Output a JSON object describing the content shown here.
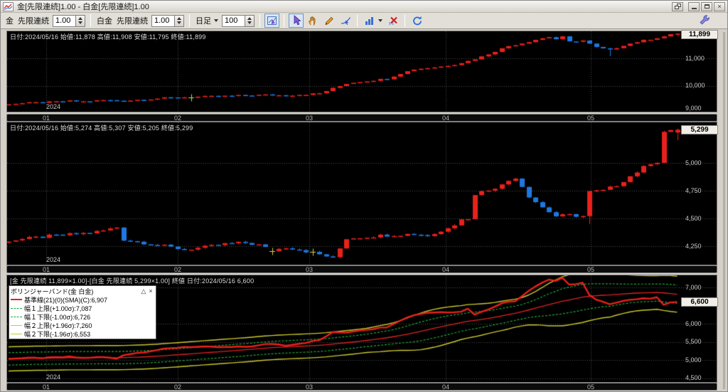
{
  "window": {
    "title": "金[先限連続]1.00 - 白金[先限連続]1.00",
    "controls": [
      "stack-windows",
      "minimize",
      "maximize",
      "close"
    ]
  },
  "toolbar": {
    "gold_label": "金",
    "gold_series": "先限連続",
    "gold_ratio": "1.00",
    "platinum_label": "白金",
    "platinum_series": "先限連続",
    "platinum_ratio": "1.00",
    "period_label": "日足",
    "bar_count": "100",
    "tool_icons": [
      "crosshair-chart",
      "select-cursor",
      "pan-hand",
      "draw-pencil",
      "trendline-cursor",
      "bar-chart-type",
      "delete-drawings",
      "refresh"
    ],
    "settings_icon": "wrench"
  },
  "year": "2024",
  "x_tick_labels": [
    "01",
    "02",
    "03",
    "04",
    "05"
  ],
  "colors": {
    "up_candle": "#e8211c",
    "down_candle": "#1e78e0",
    "doji": "#d8cf4f",
    "grid": "#4e4e4e",
    "band_inner": "#1fa83c",
    "band_outer": "#c9c92c",
    "centerline": "#dd2222",
    "spread_line": "#e8211c"
  },
  "chart_data": [
    {
      "type": "candlestick",
      "instrument": "金 先限連続",
      "multiplier": "1.00",
      "info": "日付:2024/05/16 始値:11,878 高値:11,908 安値:11,795 終値:11,899",
      "date": "2024/05/16",
      "open": 11878,
      "high": 11908,
      "low": 11795,
      "close": 11899,
      "badge": "11,899",
      "y_ticks": [
        {
          "v": 11000,
          "label": "11,000"
        },
        {
          "v": 10000,
          "label": "10,000"
        },
        {
          "v": 9000,
          "label": "9,000"
        }
      ],
      "close_keyframes": [
        [
          0,
          9340
        ],
        [
          3,
          9370
        ],
        [
          6,
          9400
        ],
        [
          9,
          9440
        ],
        [
          11,
          9420
        ],
        [
          14,
          9470
        ],
        [
          17,
          9450
        ],
        [
          20,
          9500
        ],
        [
          23,
          9550
        ],
        [
          26,
          9580
        ],
        [
          29,
          9600
        ],
        [
          32,
          9620
        ],
        [
          35,
          9645
        ],
        [
          38,
          9665
        ],
        [
          41,
          9645
        ],
        [
          44,
          9685
        ],
        [
          46,
          9720
        ],
        [
          48,
          9900
        ],
        [
          50,
          10080
        ],
        [
          52,
          10150
        ],
        [
          54,
          10200
        ],
        [
          56,
          10260
        ],
        [
          58,
          10450
        ],
        [
          60,
          10600
        ],
        [
          62,
          10650
        ],
        [
          64,
          10700
        ],
        [
          66,
          10780
        ],
        [
          68,
          10900
        ],
        [
          70,
          11060
        ],
        [
          72,
          11260
        ],
        [
          74,
          11450
        ],
        [
          76,
          11550
        ],
        [
          78,
          11680
        ],
        [
          80,
          11780
        ],
        [
          81,
          11700
        ],
        [
          82,
          11780
        ],
        [
          83,
          11600
        ],
        [
          85,
          11650
        ],
        [
          87,
          11400
        ],
        [
          89,
          11300
        ],
        [
          91,
          11480
        ],
        [
          93,
          11600
        ],
        [
          95,
          11700
        ],
        [
          97,
          11800
        ],
        [
          98,
          11860
        ],
        [
          99,
          11899
        ]
      ],
      "doji_indices": [
        27
      ],
      "wick_low_overrides": {
        "89": 11080,
        "99": 11795
      },
      "wick_high_overrides": {
        "99": 11908
      },
      "open_overrides": {
        "99": 11878
      }
    },
    {
      "type": "candlestick",
      "instrument": "白金 先限連続",
      "multiplier": "1.00",
      "info": "日付:2024/05/16 始値:5,274 高値:5,307 安値:5,205 終値:5,299",
      "date": "2024/05/16",
      "open": 5274,
      "high": 5307,
      "low": 5205,
      "close": 5299,
      "badge": "5,299",
      "y_ticks": [
        {
          "v": 5000,
          "label": "5,000"
        },
        {
          "v": 4750,
          "label": "4,750"
        },
        {
          "v": 4500,
          "label": "4,500"
        },
        {
          "v": 4250,
          "label": "4,250"
        }
      ],
      "close_keyframes": [
        [
          0,
          4300
        ],
        [
          3,
          4320
        ],
        [
          6,
          4340
        ],
        [
          9,
          4355
        ],
        [
          12,
          4370
        ],
        [
          14,
          4390
        ],
        [
          16,
          4420
        ],
        [
          17,
          4310
        ],
        [
          20,
          4280
        ],
        [
          23,
          4250
        ],
        [
          26,
          4220
        ],
        [
          29,
          4240
        ],
        [
          32,
          4270
        ],
        [
          35,
          4280
        ],
        [
          37,
          4260
        ],
        [
          39,
          4210
        ],
        [
          41,
          4240
        ],
        [
          43,
          4220
        ],
        [
          45,
          4190
        ],
        [
          47,
          4160
        ],
        [
          48,
          4140
        ],
        [
          50,
          4320
        ],
        [
          52,
          4330
        ],
        [
          54,
          4340
        ],
        [
          56,
          4350
        ],
        [
          58,
          4355
        ],
        [
          60,
          4360
        ],
        [
          62,
          4345
        ],
        [
          64,
          4380
        ],
        [
          65,
          4420
        ],
        [
          66,
          4450
        ],
        [
          67,
          4500
        ],
        [
          68,
          4490
        ],
        [
          69,
          4720
        ],
        [
          71,
          4760
        ],
        [
          73,
          4800
        ],
        [
          74,
          4840
        ],
        [
          75,
          4870
        ],
        [
          76,
          4790
        ],
        [
          77,
          4700
        ],
        [
          79,
          4600
        ],
        [
          81,
          4520
        ],
        [
          83,
          4530
        ],
        [
          85,
          4520
        ],
        [
          86,
          4740
        ],
        [
          88,
          4750
        ],
        [
          90,
          4800
        ],
        [
          92,
          4880
        ],
        [
          94,
          4960
        ],
        [
          95,
          5000
        ],
        [
          96,
          5010
        ],
        [
          97,
          5280
        ],
        [
          98,
          5285
        ],
        [
          99,
          5299
        ]
      ],
      "doji_indices": [
        39,
        45
      ],
      "wick_low_overrides": {
        "86": 4450,
        "99": 5205
      },
      "wick_high_overrides": {
        "99": 5307
      },
      "open_overrides": {
        "99": 5274
      }
    },
    {
      "type": "line-spread",
      "header": "[金 先限連続 11,899×1.00]-[白金 先限連続 5,299×1.00] 終値 日付:2024/05/16 6,600",
      "close": 6600,
      "badge": "6,600",
      "y_ticks": [
        {
          "v": 7000,
          "label": "7,000"
        },
        {
          "v": 6000,
          "label": "6,000"
        },
        {
          "v": 5500,
          "label": "5,500"
        },
        {
          "v": 5000,
          "label": "5,000"
        },
        {
          "v": 4500,
          "label": "4,500"
        }
      ],
      "legend": {
        "title": "ボリンジャーバンド(金 白金)",
        "buttons": [
          "△",
          "×"
        ],
        "period": 21,
        "sigma1": 1.0,
        "sigma2": 1.96,
        "items": [
          {
            "label": "基準線(21)(0)(SMA)(C):6,907",
            "color": "#dd2222",
            "style": "solid",
            "width": 2
          },
          {
            "label": "幅１上限(+1.00σ):7,087",
            "color": "#1fa83c",
            "style": "dashed",
            "width": 1
          },
          {
            "label": "幅１下限(-1.00σ):6,726",
            "color": "#1fa83c",
            "style": "dashed",
            "width": 1
          },
          {
            "label": "幅２上限(+1.96σ):7,260",
            "color": "#c9c92c",
            "style": "solid",
            "width": 1
          },
          {
            "label": "幅２下限(-1.96σ):6,553",
            "color": "#c9c92c",
            "style": "solid",
            "width": 1
          }
        ],
        "values": {
          "sma": 6907,
          "upper1": 7087,
          "lower1": 6726,
          "upper2": 7260,
          "lower2": 6553
        }
      }
    }
  ]
}
